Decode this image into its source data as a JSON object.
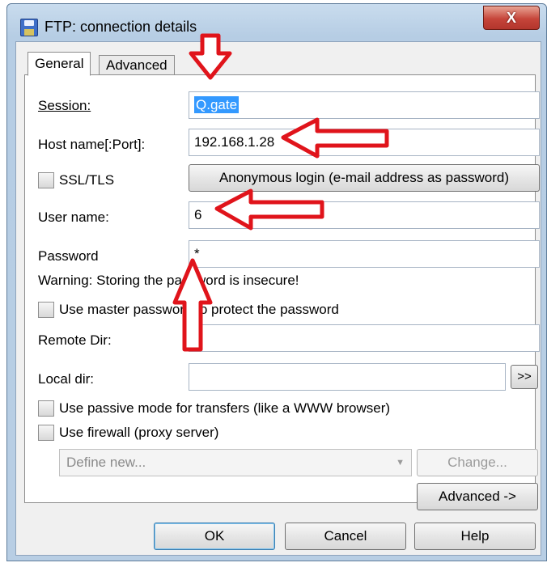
{
  "window": {
    "title": "FTP: connection details",
    "close_symbol": "X"
  },
  "tabs": [
    {
      "label": "General",
      "active": true
    },
    {
      "label": "Advanced",
      "active": false
    }
  ],
  "form": {
    "session_label": "Session:",
    "session_value": "Q.gate",
    "host_label": "Host name[:Port]:",
    "host_value": "192.168.1.28",
    "ssl_label": "SSL/TLS",
    "ssl_checked": false,
    "anon_button": "Anonymous login (e-mail address as password)",
    "user_label": "User name:",
    "user_value": "6",
    "password_label": "Password",
    "password_value": "*",
    "warning": "Warning: Storing the password is insecure!",
    "master_pw_label": "Use master password to protect the password",
    "master_pw_checked": false,
    "remote_dir_label": "Remote Dir:",
    "remote_dir_value": "",
    "local_dir_label": "Local dir:",
    "local_dir_value": "",
    "browse_button": ">>",
    "passive_label": "Use passive mode for transfers (like a WWW browser)",
    "passive_checked": false,
    "firewall_label": "Use firewall (proxy server)",
    "firewall_checked": false,
    "proxy_select": "Define new...",
    "change_button": "Change...",
    "advanced_button": "Advanced ->"
  },
  "footer": {
    "ok": "OK",
    "cancel": "Cancel",
    "help": "Help"
  },
  "annotation_color": "#e0141b"
}
